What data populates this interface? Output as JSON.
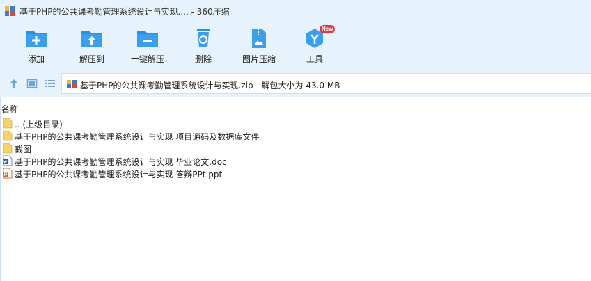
{
  "window": {
    "title": "基于PHP的公共课考勤管理系统设计与实现.... - 360压缩"
  },
  "toolbar": {
    "items": [
      {
        "label": "添加",
        "icon": "add-folder-icon"
      },
      {
        "label": "解压到",
        "icon": "extract-to-icon"
      },
      {
        "label": "一键解压",
        "icon": "one-click-extract-icon"
      },
      {
        "label": "删除",
        "icon": "recycle-delete-icon"
      },
      {
        "label": "图片压缩",
        "icon": "image-compress-icon"
      },
      {
        "label": "工具",
        "icon": "tools-icon",
        "badge": "New"
      }
    ]
  },
  "address": {
    "text": "基于PHP的公共课考勤管理系统设计与实现.zip - 解包大小为 43.0 MB"
  },
  "list": {
    "header": "名称",
    "items": [
      {
        "name": ".. (上级目录)",
        "type": "folder"
      },
      {
        "name": "基于PHP的公共课考勤管理系统设计与实现 项目源码及数据库文件",
        "type": "folder-doc"
      },
      {
        "name": "截图",
        "type": "folder"
      },
      {
        "name": "基于PHP的公共课考勤管理系统设计与实现 毕业论文.doc",
        "type": "doc"
      },
      {
        "name": "基于PHP的公共课考勤管理系统设计与实现 答辩PPt.ppt",
        "type": "ppt"
      }
    ]
  },
  "colors": {
    "toolbar_bg": "#e6f2fc",
    "icon_blue": "#2a8fe0",
    "folder_yellow": "#f6d26b",
    "badge_red": "#e8353b"
  }
}
